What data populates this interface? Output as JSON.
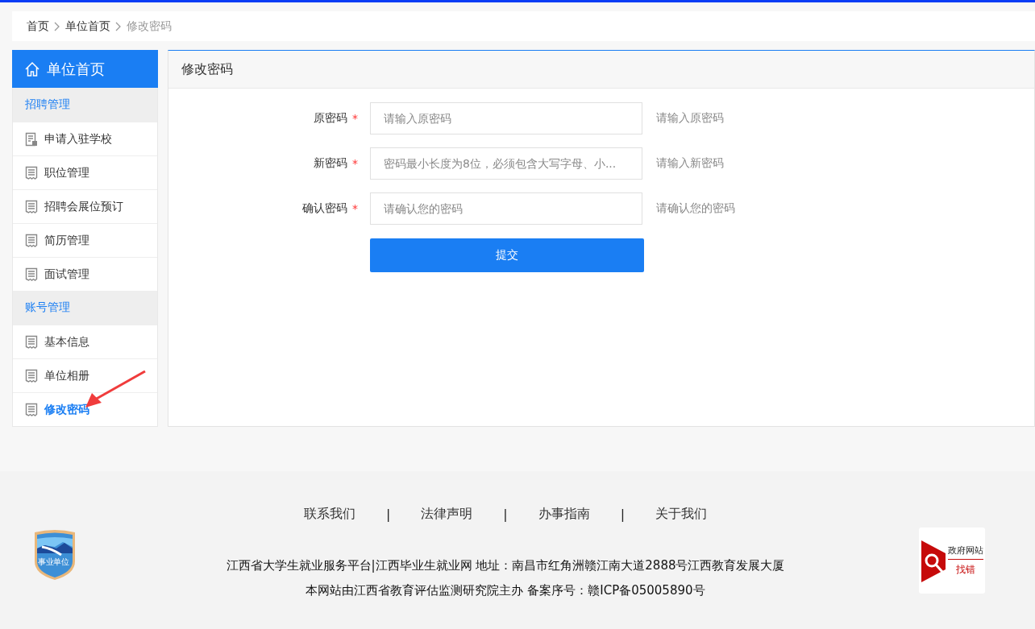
{
  "breadcrumb": [
    {
      "label": "首页",
      "current": false
    },
    {
      "label": "单位首页",
      "current": false
    },
    {
      "label": "修改密码",
      "current": true
    }
  ],
  "sidebar": {
    "title": "单位首页",
    "groups": [
      {
        "label": "招聘管理",
        "items": [
          {
            "label": "申请入驻学校",
            "kind": "form",
            "selected": false
          },
          {
            "label": "职位管理",
            "kind": "list",
            "selected": false
          },
          {
            "label": "招聘会展位预订",
            "kind": "list",
            "selected": false
          },
          {
            "label": "简历管理",
            "kind": "list",
            "selected": false
          },
          {
            "label": "面试管理",
            "kind": "list",
            "selected": false
          }
        ]
      },
      {
        "label": "账号管理",
        "items": [
          {
            "label": "基本信息",
            "kind": "list",
            "selected": false
          },
          {
            "label": "单位相册",
            "kind": "list",
            "selected": false
          },
          {
            "label": "修改密码",
            "kind": "list",
            "selected": true
          }
        ]
      }
    ]
  },
  "annotation": {
    "kind": "arrow"
  },
  "panel": {
    "title": "修改密码",
    "fields": [
      {
        "label": "原密码",
        "required_mark": "*",
        "placeholder": "请输入原密码",
        "hint": "请输入原密码"
      },
      {
        "label": "新密码",
        "required_mark": "*",
        "placeholder": "密码最小长度为8位，必须包含大写字母、小...",
        "hint": "请输入新密码"
      },
      {
        "label": "确认密码",
        "required_mark": "*",
        "placeholder": "请确认您的密码",
        "hint": "请确认您的密码"
      }
    ],
    "submit": "提交"
  },
  "footer": {
    "badge": "事业单位",
    "links": [
      "联系我们",
      "法律声明",
      "办事指南",
      "关于我们"
    ],
    "separators": [
      "|",
      "|",
      "|"
    ],
    "lines": [
      "江西省大学生就业服务平台|江西毕业生就业网 地址：南昌市红角洲赣江南大道2888号江西教育发展大厦",
      "本网站由江西省教育评估监测研究院主办   备案序号：赣ICP备05005890号"
    ],
    "report": {
      "title": "政府网站",
      "subtitle": "找错"
    }
  }
}
